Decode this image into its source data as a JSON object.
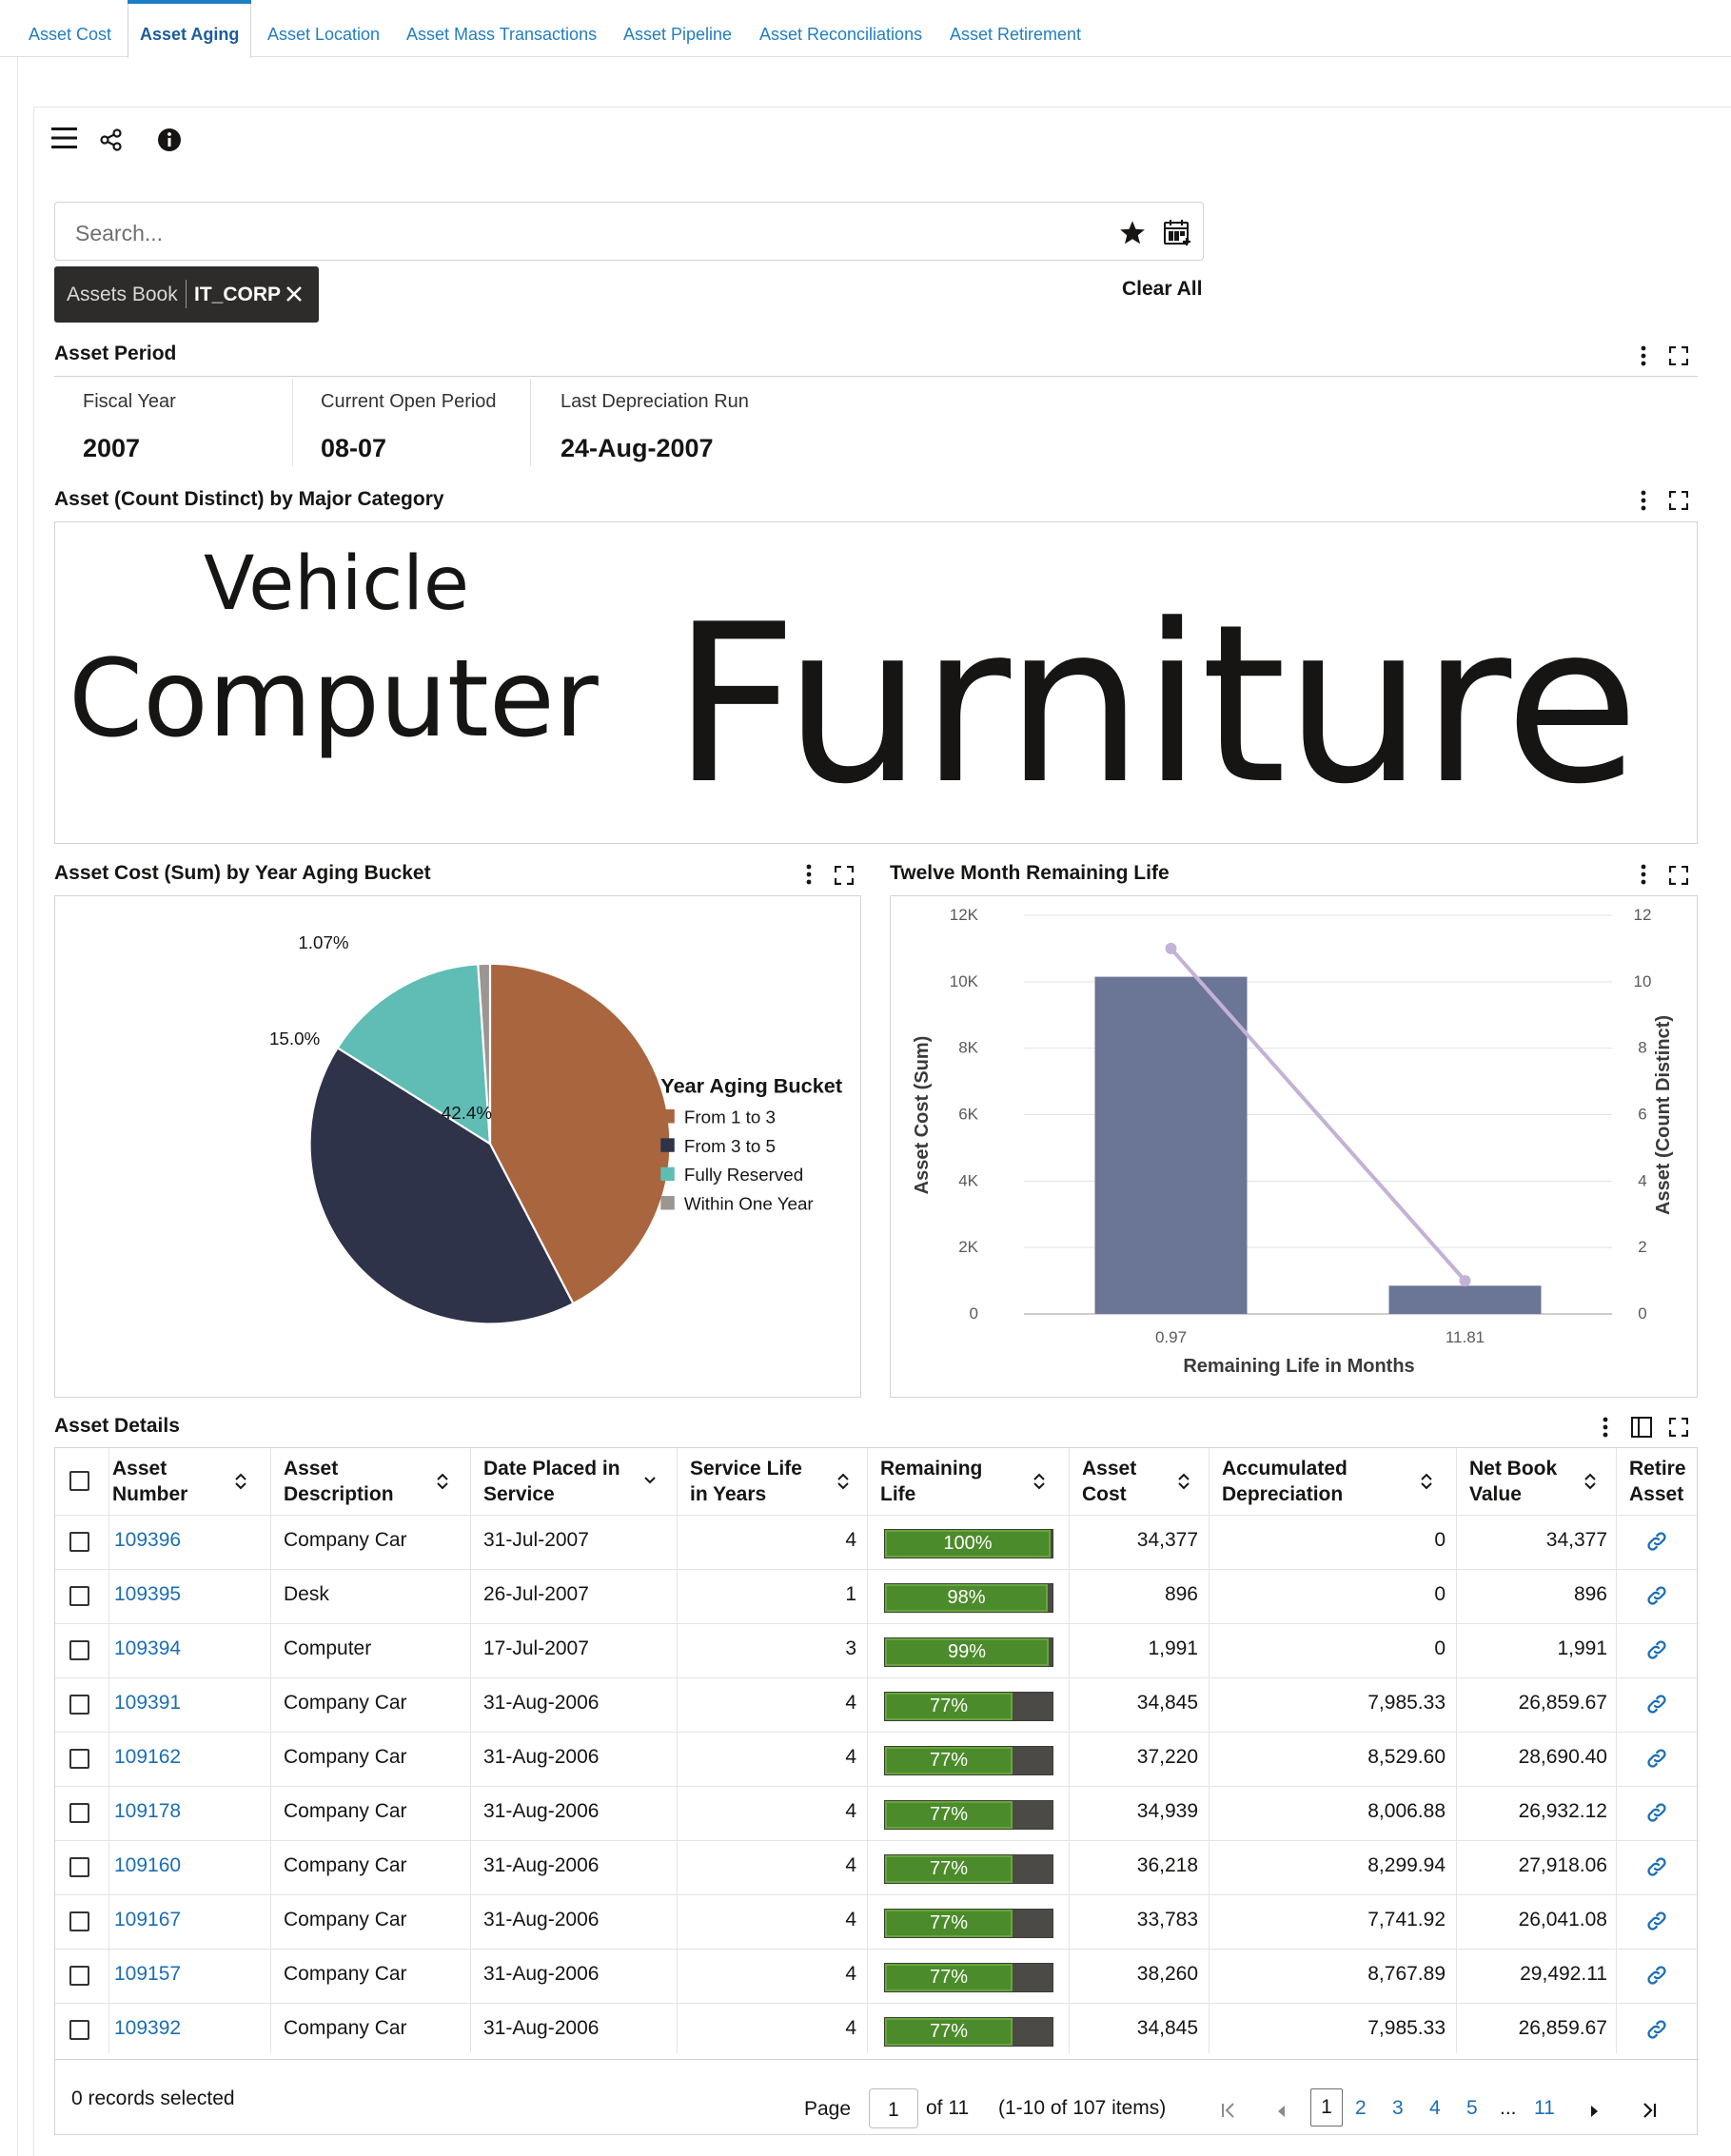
{
  "tabs": [
    {
      "label": "Asset Cost",
      "active": false
    },
    {
      "label": "Asset Aging",
      "active": true
    },
    {
      "label": "Asset Location",
      "active": false
    },
    {
      "label": "Asset Mass Transactions",
      "active": false
    },
    {
      "label": "Asset Pipeline",
      "active": false
    },
    {
      "label": "Asset Reconciliations",
      "active": false
    },
    {
      "label": "Asset Retirement",
      "active": false
    }
  ],
  "search": {
    "placeholder": "Search..."
  },
  "filter_chip": {
    "key": "Assets Book",
    "value": "IT_CORP"
  },
  "clear_all": "Clear All",
  "asset_period": {
    "title": "Asset Period",
    "stats": [
      {
        "label": "Fiscal Year",
        "value": "2007"
      },
      {
        "label": "Current Open Period",
        "value": "08-07"
      },
      {
        "label": "Last Depreciation Run",
        "value": "24-Aug-2007"
      }
    ]
  },
  "tag_cloud": {
    "title": "Asset (Count Distinct) by Major Category",
    "words": [
      "Vehicle",
      "Computer",
      "Furniture"
    ]
  },
  "pie_title": "Asset Cost (Sum) by Year Aging Bucket",
  "combo_title": "Twelve Month Remaining Life",
  "chart_data": [
    {
      "type": "pie",
      "title": "Asset Cost (Sum) by Year Aging Bucket",
      "legend_title": "Year Aging Bucket",
      "legend_position": "right",
      "slices": [
        {
          "name": "From 1 to 3",
          "percent": 42.4,
          "label": "42.4%",
          "color": "#a9653d"
        },
        {
          "name": "From 3 to 5",
          "percent": 41.6,
          "label": "41.6%",
          "color": "#2e3349"
        },
        {
          "name": "Fully Reserved",
          "percent": 15.0,
          "label": "15.0%",
          "color": "#5fbdb6"
        },
        {
          "name": "Within One Year",
          "percent": 1.07,
          "label": "1.07%",
          "color": "#9a9690"
        }
      ]
    },
    {
      "type": "bar",
      "title": "Twelve Month Remaining Life",
      "xlabel": "Remaining Life in Months",
      "ylabel": "Asset Cost (Sum)",
      "y2label": "Asset (Count Distinct)",
      "categories": [
        "0.97",
        "11.81"
      ],
      "series": [
        {
          "name": "Asset Cost (Sum)",
          "type": "bar",
          "axis": "y",
          "values": [
            10150,
            850
          ],
          "color": "#6b7596"
        },
        {
          "name": "Asset (Count Distinct)",
          "type": "line",
          "axis": "y2",
          "values": [
            11,
            1
          ],
          "color": "#c3b2d6"
        }
      ],
      "ylim": [
        0,
        12000
      ],
      "y2lim": [
        0,
        12
      ],
      "yticks": [
        "0",
        "2K",
        "4K",
        "6K",
        "8K",
        "10K",
        "12K"
      ],
      "y2ticks": [
        "0",
        "2",
        "4",
        "6",
        "8",
        "10",
        "12"
      ],
      "grid": true
    }
  ],
  "details": {
    "title": "Asset Details",
    "columns": [
      "Asset Number",
      "Asset Description",
      "Date Placed in Service",
      "Service Life in Years",
      "Remaining Life",
      "Asset Cost",
      "Accumulated Depreciation",
      "Net Book Value",
      "Retire Asset"
    ],
    "rows": [
      {
        "num": "109396",
        "desc": "Company Car",
        "date": "31-Jul-2007",
        "life": "4",
        "rem": "100%",
        "rem_value": 100,
        "cost": "34,377",
        "acc": "0",
        "nbv": "34,377"
      },
      {
        "num": "109395",
        "desc": "Desk",
        "date": "26-Jul-2007",
        "life": "1",
        "rem": "98%",
        "rem_value": 98,
        "cost": "896",
        "acc": "0",
        "nbv": "896"
      },
      {
        "num": "109394",
        "desc": "Computer",
        "date": "17-Jul-2007",
        "life": "3",
        "rem": "99%",
        "rem_value": 99,
        "cost": "1,991",
        "acc": "0",
        "nbv": "1,991"
      },
      {
        "num": "109391",
        "desc": "Company Car",
        "date": "31-Aug-2006",
        "life": "4",
        "rem": "77%",
        "rem_value": 77,
        "cost": "34,845",
        "acc": "7,985.33",
        "nbv": "26,859.67"
      },
      {
        "num": "109162",
        "desc": "Company Car",
        "date": "31-Aug-2006",
        "life": "4",
        "rem": "77%",
        "rem_value": 77,
        "cost": "37,220",
        "acc": "8,529.60",
        "nbv": "28,690.40"
      },
      {
        "num": "109178",
        "desc": "Company Car",
        "date": "31-Aug-2006",
        "life": "4",
        "rem": "77%",
        "rem_value": 77,
        "cost": "34,939",
        "acc": "8,006.88",
        "nbv": "26,932.12"
      },
      {
        "num": "109160",
        "desc": "Company Car",
        "date": "31-Aug-2006",
        "life": "4",
        "rem": "77%",
        "rem_value": 77,
        "cost": "36,218",
        "acc": "8,299.94",
        "nbv": "27,918.06"
      },
      {
        "num": "109167",
        "desc": "Company Car",
        "date": "31-Aug-2006",
        "life": "4",
        "rem": "77%",
        "rem_value": 77,
        "cost": "33,783",
        "acc": "7,741.92",
        "nbv": "26,041.08"
      },
      {
        "num": "109157",
        "desc": "Company Car",
        "date": "31-Aug-2006",
        "life": "4",
        "rem": "77%",
        "rem_value": 77,
        "cost": "38,260",
        "acc": "8,767.89",
        "nbv": "29,492.11"
      },
      {
        "num": "109392",
        "desc": "Company Car",
        "date": "31-Aug-2006",
        "life": "4",
        "rem": "77%",
        "rem_value": 77,
        "cost": "34,845",
        "acc": "7,985.33",
        "nbv": "26,859.67"
      }
    ]
  },
  "footer": {
    "selected": "0 records selected",
    "page_label": "Page",
    "page_value": "1",
    "of_pages": "of 11",
    "items": "(1-10 of 107 items)",
    "pages": [
      "1",
      "2",
      "3",
      "4",
      "5",
      "...",
      "11"
    ]
  },
  "icons": [
    "hamburger-icon",
    "share-icon",
    "info-icon",
    "star-icon",
    "calendar-icon",
    "close-icon",
    "kebab-icon",
    "expand-icon",
    "sort-icon",
    "column-icon",
    "link-icon",
    "first-page-icon",
    "prev-page-icon",
    "next-page-icon",
    "last-page-icon"
  ]
}
